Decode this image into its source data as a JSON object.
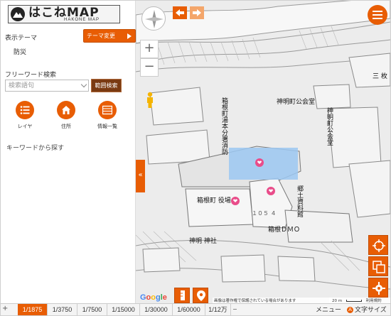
{
  "app": {
    "logo_text": "はこねMAP",
    "logo_subtitle": "HAKONE MAP"
  },
  "sidebar": {
    "theme_label": "表示テーマ",
    "theme_value": "防災",
    "theme_change_button": "テーマ変更",
    "keyword_label": "フリーワード検索",
    "keyword_placeholder": "検索語句",
    "range_search_button": "範囲検索",
    "tools": [
      {
        "label": "レイヤ",
        "icon": "layer-list-icon"
      },
      {
        "label": "住所",
        "icon": "house-icon"
      },
      {
        "label": "情報一覧",
        "icon": "table-list-icon"
      }
    ],
    "keyword_search_link": "キーワードから探す"
  },
  "map": {
    "labels": {
      "kouminkan": "神明町公会堂",
      "kouminkan_vertical": "神明町公会堂",
      "fire_station": "箱根町湯本分署消防",
      "town_office": "箱根町 役場",
      "kyodo_shiryokan": "郷土資料館",
      "dmo": "箱根ＤＭＯ",
      "shinmei_jinja": "神明 神社",
      "lot_number": "１０５ ４",
      "mitsu": "三 枚"
    },
    "google": "Google",
    "copyright": "画像は著作権で保護されている場合があります",
    "scale_text": "20 m",
    "terms": "利用規約",
    "highlight_color": "#9cc8f2",
    "accent_color": "#e85d04"
  },
  "controls": {
    "zoom_in": "+",
    "zoom_out": "−",
    "collapse": "«"
  },
  "bottom_bar": {
    "plus": "+",
    "scales": [
      "1/1875",
      "1/3750",
      "1/7500",
      "1/15000",
      "1/30000",
      "1/60000",
      "1/12万"
    ],
    "active_scale": "1/1875",
    "scroll": "−",
    "menu": "メニュー",
    "text_size": "文字サイズ"
  }
}
